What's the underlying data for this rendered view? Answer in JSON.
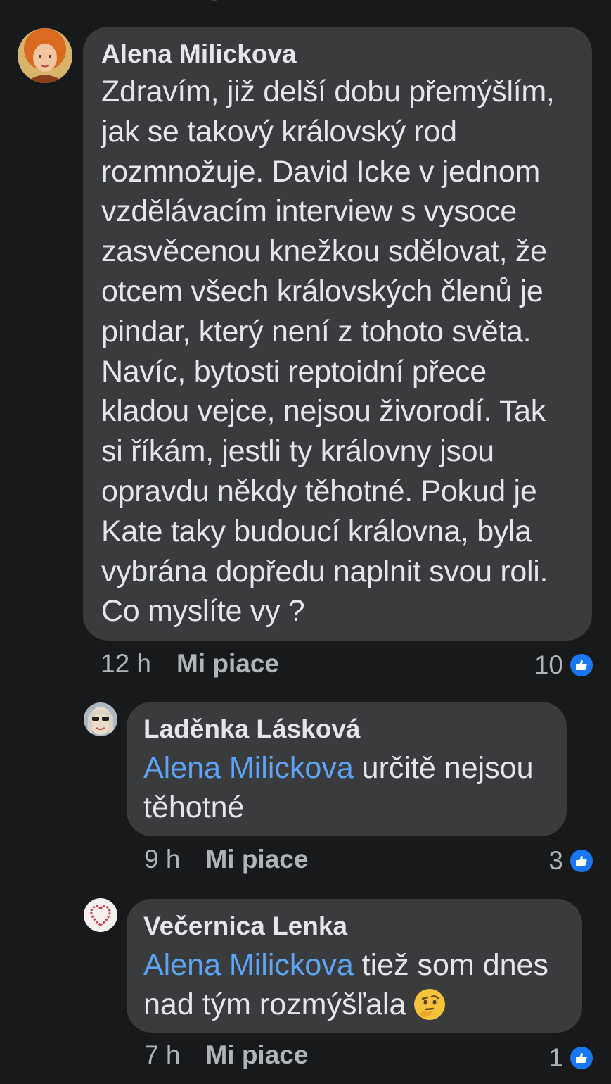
{
  "comments": [
    {
      "author": "Alena Milickova",
      "text": "Zdravím, již delší dobu přemýšlím, jak se takový královský rod rozmnožuje. David Icke v jednom vzdělávacím interview s vysoce zasvěcenou knežkou sdělovat, že otcem všech královských členů je pindar, který není z tohoto světa. Navíc, bytosti reptoidní přece kladou vejce, nejsou živorodí. Tak si říkám, jestli ty královny jsou opravdu někdy těhotné. Pokud je Kate taky budoucí královna, byla vybrána dopředu naplnit svou roli. Co myslíte vy ?",
      "time": "12 h",
      "like_label": "Mi piace",
      "reaction_count": "10",
      "reaction_icon": "like-icon",
      "avatar_colors": [
        "#e8a24c",
        "#c96a2b"
      ]
    }
  ],
  "replies": [
    {
      "author": "Laděnka Lásková",
      "mention": "Alena Milickova",
      "text": " určitě nejsou těhotné",
      "time": "9 h",
      "like_label": "Mi piace",
      "reaction_count": "3",
      "reaction_icon": "like-icon"
    },
    {
      "author": "Večernica Lenka",
      "mention": "Alena Milickova",
      "text": " tiež som dnes nad tým rozmýšľala ",
      "emoji": "thinking-face-emoji",
      "time": "7 h",
      "like_label": "Mi piace",
      "reaction_count": "1",
      "reaction_icon": "like-icon"
    }
  ],
  "colors": {
    "background": "#18191a",
    "bubble": "#3a3b3c",
    "text": "#e4e6eb",
    "meta": "#b0b3b8",
    "mention": "#5ea4f6",
    "like_badge": "#1877f2"
  }
}
